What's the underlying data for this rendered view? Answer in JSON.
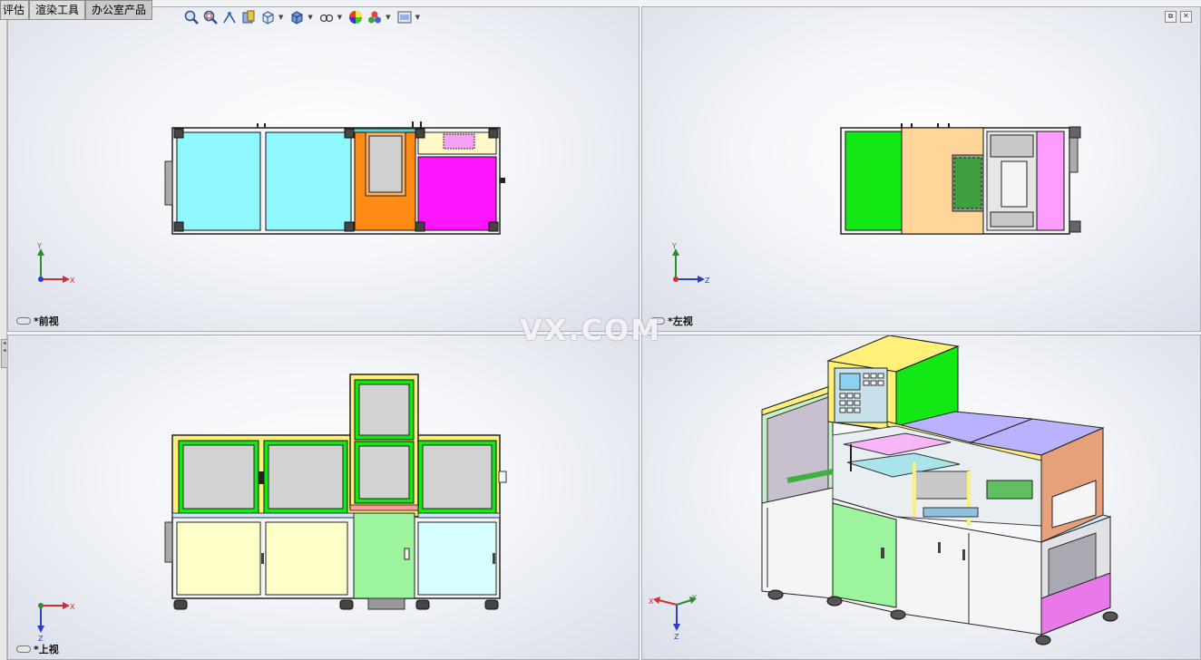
{
  "tabs": [
    {
      "label": "评估"
    },
    {
      "label": "渲染工具"
    },
    {
      "label": "办公室产品"
    }
  ],
  "toolbar": {
    "icons": [
      "zoom-to-fit-icon",
      "zoom-area-icon",
      "previous-view-icon",
      "section-view-icon",
      "view-orientation-icon",
      "display-style-icon",
      "hide-show-icon",
      "appearance-icon",
      "scene-icon",
      "view-settings-icon"
    ]
  },
  "viewports": {
    "front": {
      "label": "*前视"
    },
    "left": {
      "label": "*左视"
    },
    "top": {
      "label": "*上视"
    },
    "iso": {
      "label": ""
    }
  },
  "axes": {
    "front": {
      "up": "Y",
      "right": "X"
    },
    "left": {
      "up": "Y",
      "right": "Z"
    },
    "top": {
      "up": "X",
      "down": "Z"
    },
    "iso": {
      "a": "X",
      "b": "Y",
      "c": "Z"
    }
  },
  "watermark": "VX.COM",
  "colors": {
    "cyan": "#8ff8ff",
    "orange": "#ff8a14",
    "magenta": "#ff14ff",
    "green": "#14e814",
    "peach": "#ffd59a",
    "yellow": "#fff07a",
    "lightyellow": "#ffffc8",
    "lightgreen": "#9cf59c",
    "lightcyan": "#d8ffff",
    "gray": "#d2d2d2",
    "pink": "#ff9cff",
    "lavender": "#b9b3ff",
    "terracotta": "#e6a07a",
    "lightgreen2": "#c6f0c6"
  }
}
